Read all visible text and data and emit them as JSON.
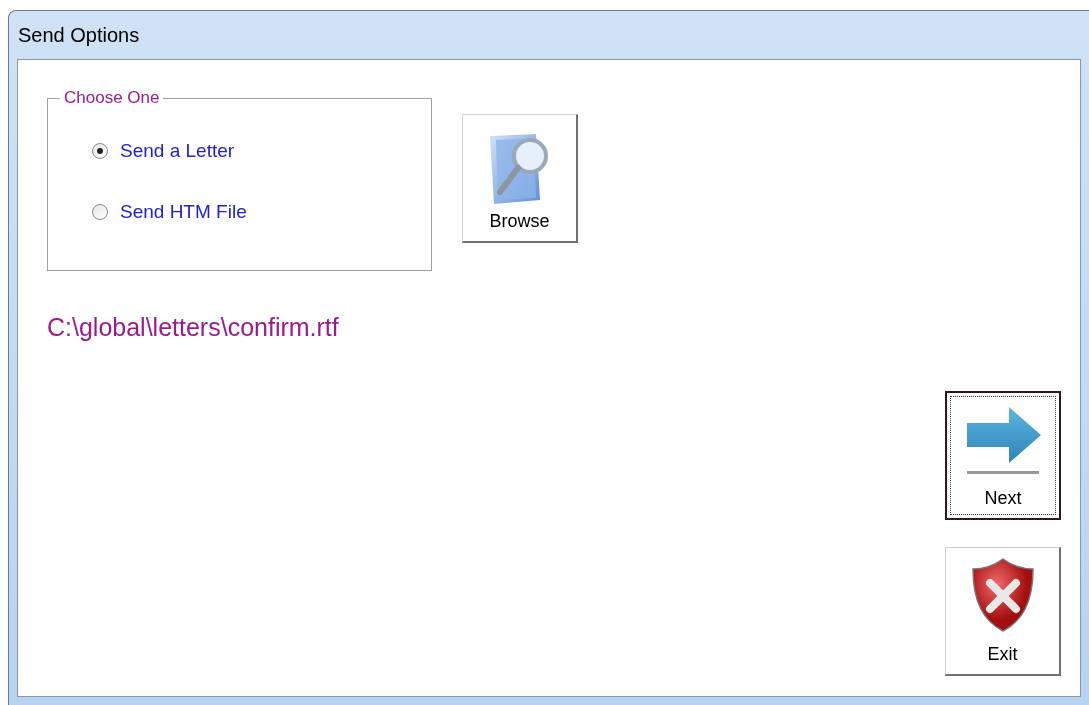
{
  "window": {
    "title": "Send Options"
  },
  "group": {
    "legend": "Choose One",
    "options": [
      {
        "label": "Send a Letter",
        "selected": true
      },
      {
        "label": "Send HTM File",
        "selected": false
      }
    ]
  },
  "browse_button": {
    "label": "Browse"
  },
  "file_path": "C:\\global\\letters\\confirm.rtf",
  "action_buttons": [
    {
      "kind": "next",
      "label": "Next",
      "focused": true
    },
    {
      "kind": "exit",
      "label": "Exit",
      "focused": false
    }
  ]
}
